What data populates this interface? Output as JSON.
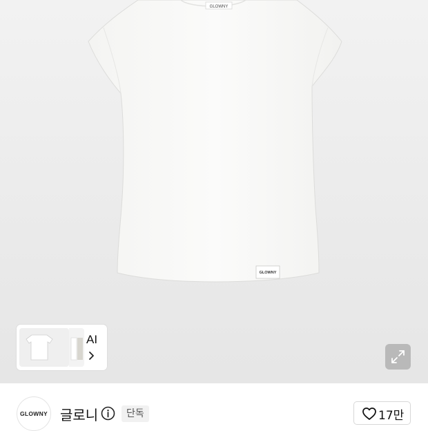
{
  "product_image": {
    "garment": "white cap-sleeve t-shirt",
    "hem_tag_text": "GLOWNY",
    "neck_label_text": "GLOWNY"
  },
  "ai_card": {
    "label": "AI",
    "icon": "chevron-right-icon"
  },
  "expand_button": {
    "icon": "expand-arrows-icon"
  },
  "brand": {
    "logo_text": "GLOWNY",
    "name": "글로니",
    "info_icon": "info-circle-icon",
    "badge": "단독"
  },
  "like": {
    "icon": "heart-outline-icon",
    "count": "17만"
  },
  "colors": {
    "hero_background": "#eeeeee",
    "expand_button_bg": "#b9b9b9",
    "badge_bg": "#f1f1f1"
  }
}
